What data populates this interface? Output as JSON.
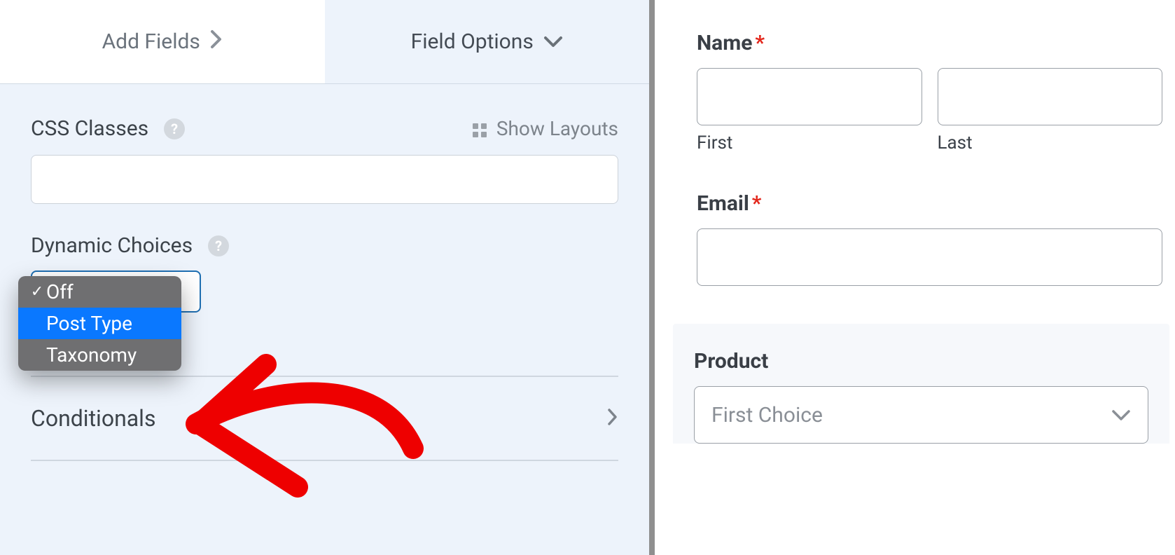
{
  "tabs": {
    "addFields": "Add Fields",
    "fieldOptions": "Field Options"
  },
  "options": {
    "cssClasses": {
      "label": "CSS Classes",
      "showLayouts": "Show Layouts",
      "value": ""
    },
    "dynamicChoices": {
      "label": "Dynamic Choices",
      "options": {
        "off": "Off",
        "postType": "Post Type",
        "taxonomy": "Taxonomy"
      }
    },
    "conditionals": "Conditionals"
  },
  "preview": {
    "name": {
      "label": "Name",
      "first": "First",
      "last": "Last"
    },
    "email": {
      "label": "Email"
    },
    "product": {
      "label": "Product",
      "placeholder": "First Choice"
    }
  }
}
